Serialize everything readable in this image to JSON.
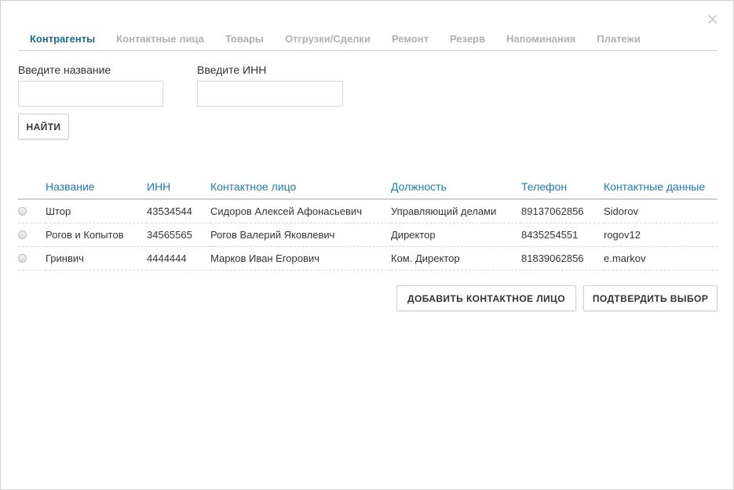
{
  "dialog": {
    "close_glyph": "×"
  },
  "tabs": [
    {
      "label": "Контрагенты",
      "active": true
    },
    {
      "label": "Контактные лица",
      "active": false
    },
    {
      "label": "Товары",
      "active": false
    },
    {
      "label": "Отгрузки/Сделки",
      "active": false
    },
    {
      "label": "Ремонт",
      "active": false
    },
    {
      "label": "Резерв",
      "active": false
    },
    {
      "label": "Напоминания",
      "active": false
    },
    {
      "label": "Платежи",
      "active": false
    }
  ],
  "search": {
    "name_label": "Введите название",
    "name_value": "",
    "inn_label": "Введите ИНН",
    "inn_value": "",
    "find_button": "НАЙТИ"
  },
  "table": {
    "columns": [
      "Название",
      "ИНН",
      "Контактное лицо",
      "Должность",
      "Телефон",
      "Контактные данные"
    ],
    "rows": [
      {
        "name": "Штор",
        "inn": "43534544",
        "contact": "Сидоров Алексей Афонасьевич",
        "position": "Управляющий делами",
        "phone": "89137062856",
        "details": "Sidorov"
      },
      {
        "name": "Рогов и Копытов",
        "inn": "34565565",
        "contact": "Рогов Валерий Яковлевич",
        "position": "Директор",
        "phone": "8435254551",
        "details": "rogov12"
      },
      {
        "name": "Гринвич",
        "inn": "4444444",
        "contact": "Марков Иван Егорович",
        "position": "Ком. Директор",
        "phone": "81839062856",
        "details": "e.markov"
      }
    ]
  },
  "actions": {
    "add_contact": "ДОБАВИТЬ КОНТАКТНОЕ ЛИЦО",
    "confirm": "ПОДТВЕРДИТЬ ВЫБОР"
  },
  "colors": {
    "accent": "#1f7bab",
    "active_tab": "#1d6a93",
    "inactive_tab": "#b0b0b0"
  }
}
